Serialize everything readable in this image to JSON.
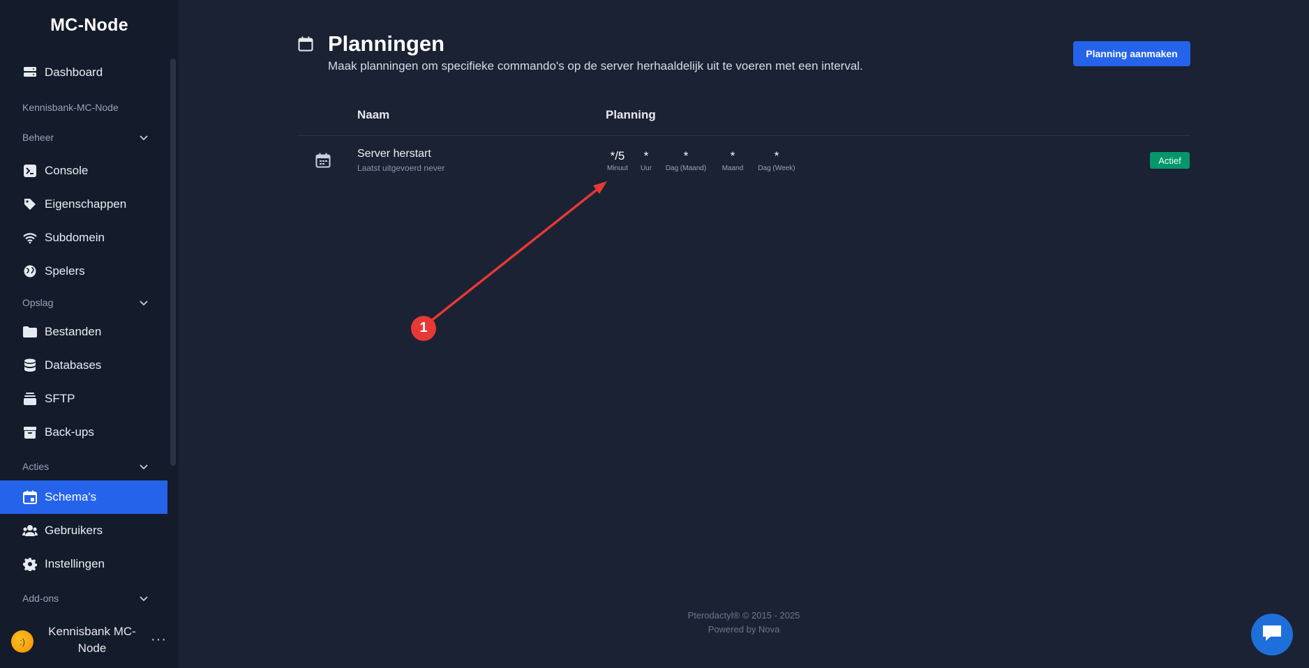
{
  "brand": "MC-Node",
  "sidebar": {
    "dashboard": "Dashboard",
    "server_name": "Kennisbank-MC-Node",
    "sections": {
      "beheer": "Beheer",
      "opslag": "Opslag",
      "acties": "Acties",
      "addons": "Add-ons"
    },
    "items": {
      "console": "Console",
      "eigenschappen": "Eigenschappen",
      "subdomein": "Subdomein",
      "spelers": "Spelers",
      "bestanden": "Bestanden",
      "databases": "Databases",
      "sftp": "SFTP",
      "backups": "Back-ups",
      "schemas": "Schema's",
      "gebruikers": "Gebruikers",
      "instellingen": "Instellingen"
    },
    "active_item": "schemas",
    "user": {
      "name": "Kennisbank MC-Node"
    }
  },
  "page": {
    "title": "Planningen",
    "subtitle": "Maak planningen om specifieke commando's op de server herhaaldelijk uit te voeren met een interval.",
    "create_button": "Planning aanmaken"
  },
  "table": {
    "headers": {
      "name": "Naam",
      "schedule": "Planning"
    },
    "rows": [
      {
        "name": "Server herstart",
        "last_run": "Laatst uitgevoerd never",
        "cron": [
          {
            "value": "*/5",
            "unit": "Minuut"
          },
          {
            "value": "*",
            "unit": "Uur"
          },
          {
            "value": "*",
            "unit": "Dag (Maand)"
          },
          {
            "value": "*",
            "unit": "Maand"
          },
          {
            "value": "*",
            "unit": "Dag (Week)"
          }
        ],
        "status": "Actief"
      }
    ]
  },
  "annotation": {
    "number": "1"
  },
  "footer": {
    "line1": "Pterodactyl® © 2015 - 2025",
    "line2": "Powered by Nova"
  },
  "colors": {
    "accent": "#2563eb",
    "status_active": "#059669",
    "annotation": "#e53935"
  }
}
